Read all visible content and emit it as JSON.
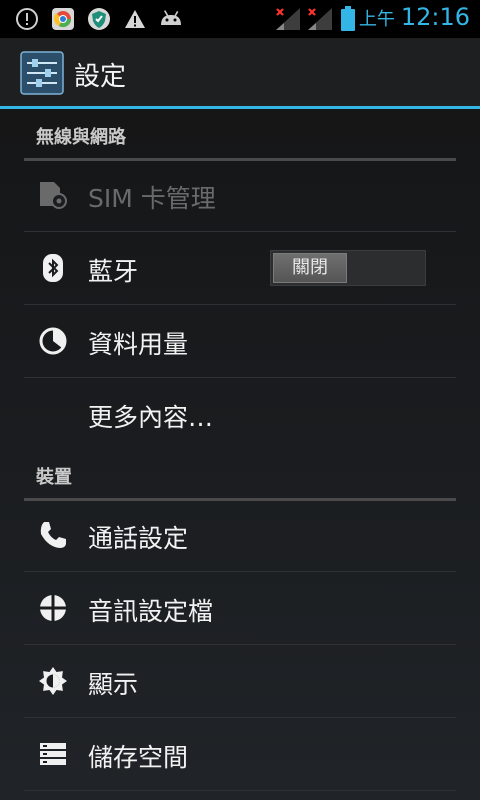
{
  "status_bar": {
    "icons": [
      "alert-icon",
      "chrome-icon",
      "shield-app-icon",
      "warning-icon",
      "android-icon"
    ],
    "signal_icons": [
      "signal-sim1-icon",
      "signal-sim2-icon"
    ],
    "battery": "battery-icon",
    "ampm": "上午",
    "time": "12:16"
  },
  "action_bar": {
    "title": "設定",
    "icon": "settings-sliders-icon"
  },
  "sections": {
    "wireless": "無線與網路",
    "device": "裝置"
  },
  "items": {
    "sim": "SIM 卡管理",
    "bluetooth": "藍牙",
    "data_usage": "資料用量",
    "more": "更多內容…",
    "call": "通話設定",
    "audio": "音訊設定檔",
    "display": "顯示",
    "storage": "儲存空間"
  },
  "bluetooth_toggle": {
    "state_label": "關閉",
    "on": false
  },
  "colors": {
    "accent": "#33b5e5",
    "background": "#1a1c1f",
    "disabled_text": "#6a6a6a"
  }
}
